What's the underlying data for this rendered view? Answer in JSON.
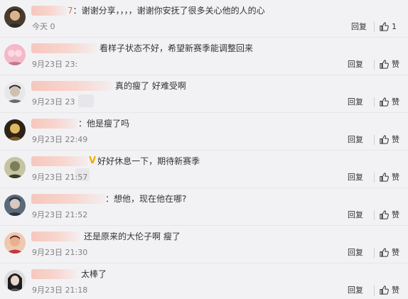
{
  "comments": [
    {
      "user_suffix": "7",
      "text": "：谢谢分享，，，，谢谢你安抚了很多关心他的人的心",
      "time": "今天 0",
      "reply_label": "回复",
      "like_label": "1",
      "avatar_colors": [
        "#4a3b2e",
        "#d9b38c",
        "#2b2b2b"
      ]
    },
    {
      "user_suffix": "",
      "text": "看样子状态不好，希望新赛季能调整回来",
      "time": "9月23日 23:",
      "reply_label": "回复",
      "like_label": "赞",
      "avatar_colors": [
        "#f4b8c8",
        "#ffd9e3",
        "#c27a8f"
      ]
    },
    {
      "user_suffix": "",
      "text": "真的瘦了 好难受啊",
      "time": "9月23日 23",
      "reply_label": "回复",
      "like_label": "赞",
      "avatar_colors": [
        "#6b6b6b",
        "#e8e8e8",
        "#2a2a2a"
      ]
    },
    {
      "user_suffix": "",
      "text": "：他是瘦了吗",
      "time": "9月23日 22:49",
      "reply_label": "回复",
      "like_label": "赞",
      "avatar_colors": [
        "#2e2416",
        "#e0b860",
        "#7a5a2a"
      ]
    },
    {
      "user_suffix": "",
      "text": "好好休息一下，期待新赛季",
      "time": "9月23日 21:57",
      "reply_label": "回复",
      "like_label": "赞",
      "avatar_colors": [
        "#7c7e5a",
        "#c6c3a2",
        "#3d3b2a"
      ]
    },
    {
      "user_suffix": "",
      "text": "：想他，现在他在哪?",
      "time": "9月23日 21:52",
      "reply_label": "回复",
      "like_label": "赞",
      "avatar_colors": [
        "#5a6a7a",
        "#d8c8c0",
        "#2c3440"
      ]
    },
    {
      "user_suffix": "",
      "text": "还是原来的大伦子啊 瘦了",
      "time": "9月23日 21:30",
      "reply_label": "回复",
      "like_label": "赞",
      "avatar_colors": [
        "#c23a3a",
        "#f0c8b0",
        "#5a2020"
      ]
    },
    {
      "user_suffix": "",
      "text": "太棒了",
      "time": "9月23日 21:18",
      "reply_label": "回复",
      "like_label": "赞",
      "avatar_colors": [
        "#1e1e1e",
        "#dcdcdc",
        "#555555"
      ]
    }
  ],
  "colors": {
    "background": "#f2f2f5",
    "text": "#333333",
    "time": "#808080",
    "username_blur": "#f6c7bd"
  },
  "icons": {
    "like": "thumbs-up-icon",
    "verified": "v-verified-icon"
  }
}
